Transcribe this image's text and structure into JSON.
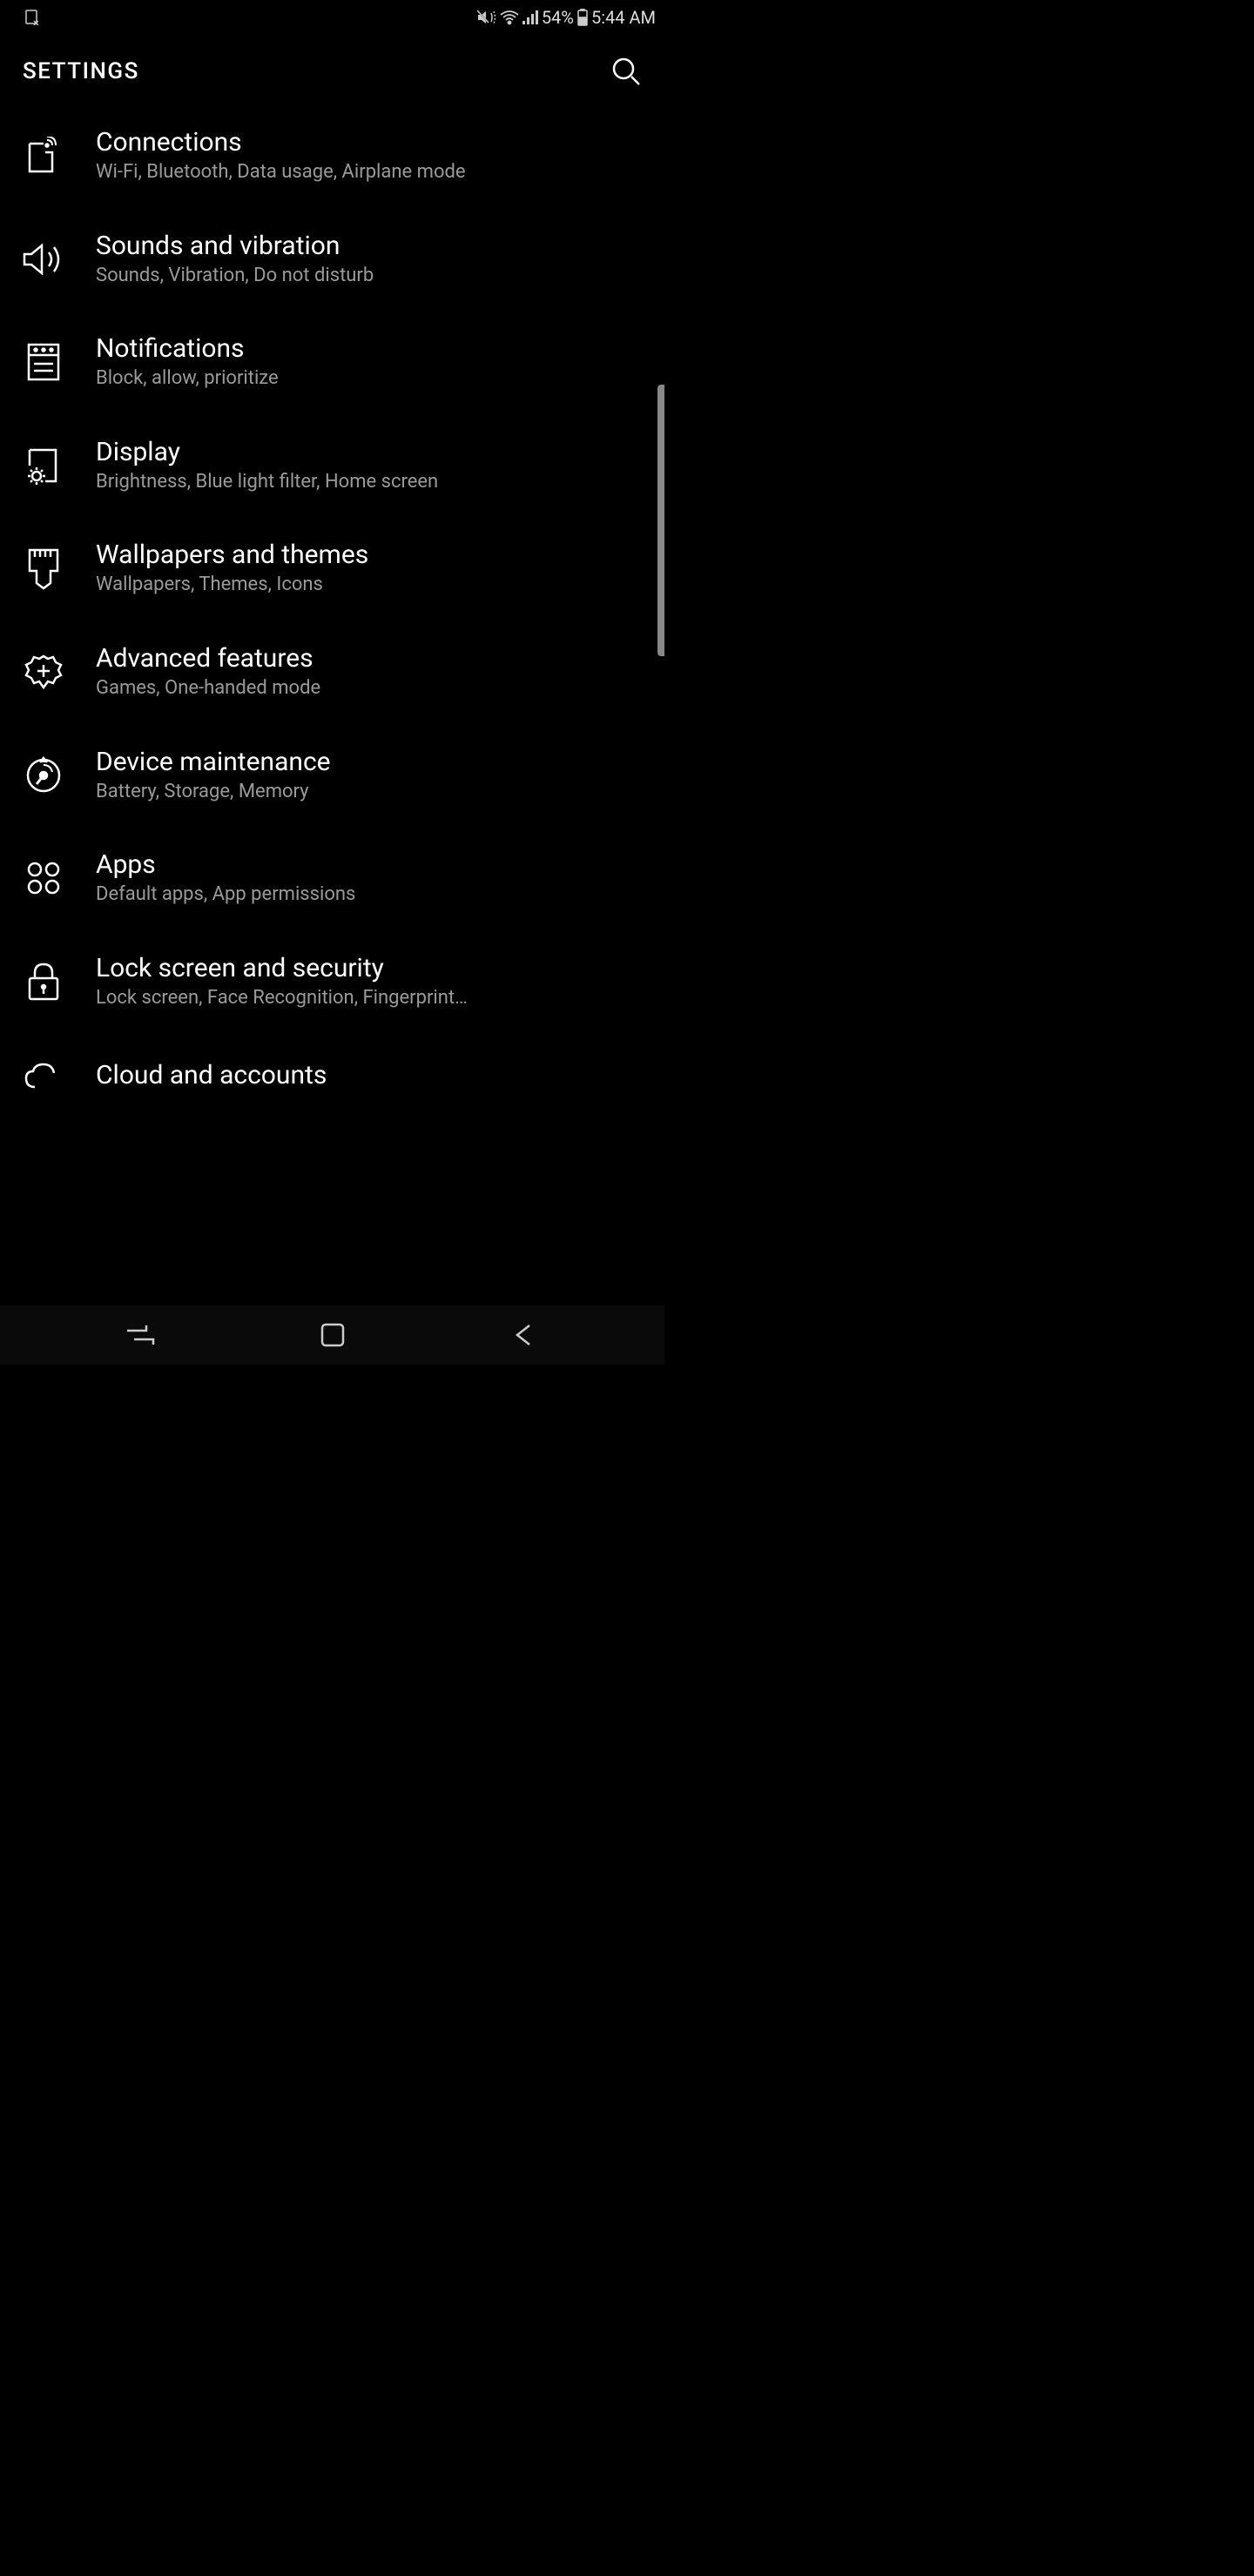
{
  "status": {
    "battery_percent": "54%",
    "time": "5:44 AM"
  },
  "header": {
    "title": "SETTINGS"
  },
  "settings": [
    {
      "icon": "connections-icon",
      "title": "Connections",
      "desc": "Wi-Fi, Bluetooth, Data usage, Airplane mode"
    },
    {
      "icon": "sound-icon",
      "title": "Sounds and vibration",
      "desc": "Sounds, Vibration, Do not disturb"
    },
    {
      "icon": "notifications-icon",
      "title": "Notifications",
      "desc": "Block, allow, prioritize"
    },
    {
      "icon": "display-icon",
      "title": "Display",
      "desc": "Brightness, Blue light filter, Home screen"
    },
    {
      "icon": "wallpapers-icon",
      "title": "Wallpapers and themes",
      "desc": "Wallpapers, Themes, Icons"
    },
    {
      "icon": "advanced-icon",
      "title": "Advanced features",
      "desc": "Games, One-handed mode"
    },
    {
      "icon": "maintenance-icon",
      "title": "Device maintenance",
      "desc": "Battery, Storage, Memory"
    },
    {
      "icon": "apps-icon",
      "title": "Apps",
      "desc": "Default apps, App permissions"
    },
    {
      "icon": "lock-icon",
      "title": "Lock screen and security",
      "desc": "Lock screen, Face Recognition, Fingerprint…"
    },
    {
      "icon": "cloud-icon",
      "title": "Cloud and accounts",
      "desc": ""
    }
  ]
}
